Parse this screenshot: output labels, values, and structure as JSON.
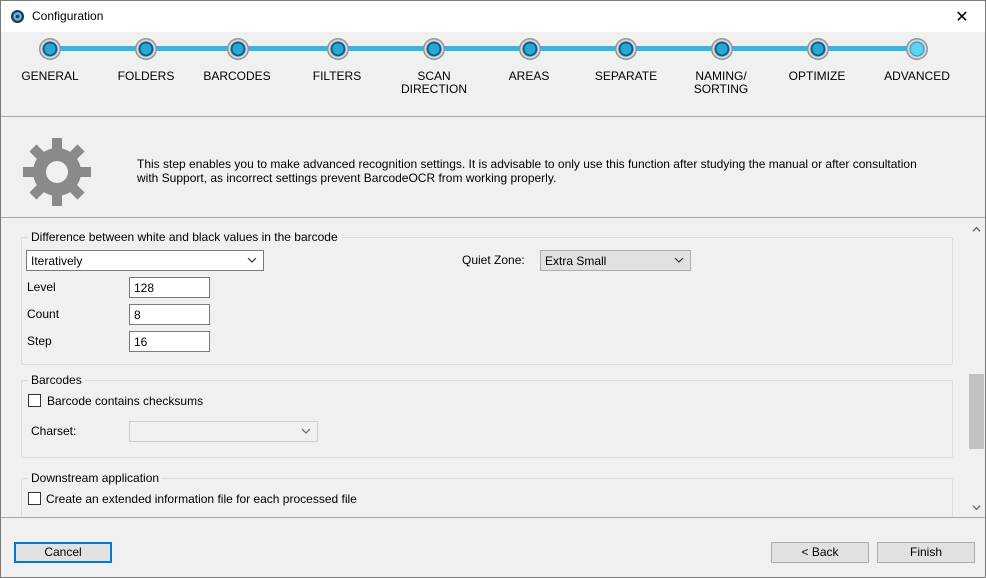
{
  "window": {
    "title": "Configuration",
    "close_glyph": "✕"
  },
  "steps": [
    {
      "label": "GENERAL",
      "icon": "step-dot-icon"
    },
    {
      "label": "FOLDERS",
      "icon": "step-dot-icon"
    },
    {
      "label": "BARCODES",
      "icon": "step-dot-icon"
    },
    {
      "label": "FILTERS",
      "icon": "step-dot-icon"
    },
    {
      "label": "SCAN DIRECTION",
      "icon": "step-dot-icon"
    },
    {
      "label": "AREAS",
      "icon": "step-dot-icon"
    },
    {
      "label": "SEPARATE",
      "icon": "step-dot-icon"
    },
    {
      "label": "NAMING/ SORTING",
      "icon": "step-dot-icon"
    },
    {
      "label": "OPTIMIZE",
      "icon": "step-dot-icon"
    },
    {
      "label": "ADVANCED",
      "icon": "step-dot-icon",
      "active": true
    }
  ],
  "info": {
    "icon": "gear-icon",
    "text": "This step enables you to make advanced recognition settings. It is advisable to only use this function after studying the manual or after consultation with Support, as incorrect settings prevent BarcodeOCR from working properly."
  },
  "difference": {
    "title": "Difference between white and black values in the barcode",
    "mode": "Iteratively",
    "level_label": "Level",
    "level_value": "128",
    "count_label": "Count",
    "count_value": "8",
    "step_label": "Step",
    "step_value": "16",
    "quiet_zone_label": "Quiet Zone:",
    "quiet_zone_value": "Extra Small"
  },
  "barcodes": {
    "title": "Barcodes",
    "checksum_label": "Barcode contains checksums",
    "checksum_checked": false,
    "charset_label": "Charset:",
    "charset_value": ""
  },
  "downstream": {
    "title": "Downstream application",
    "extended_label": "Create an extended information file for each processed file",
    "extended_checked": false
  },
  "footer": {
    "cancel_label": "Cancel",
    "back_label": "< Back",
    "finish_label": "Finish"
  },
  "colors": {
    "track": "#39b6dd",
    "active_node": "#5ed2f5",
    "default_button_border": "#0078d7"
  }
}
